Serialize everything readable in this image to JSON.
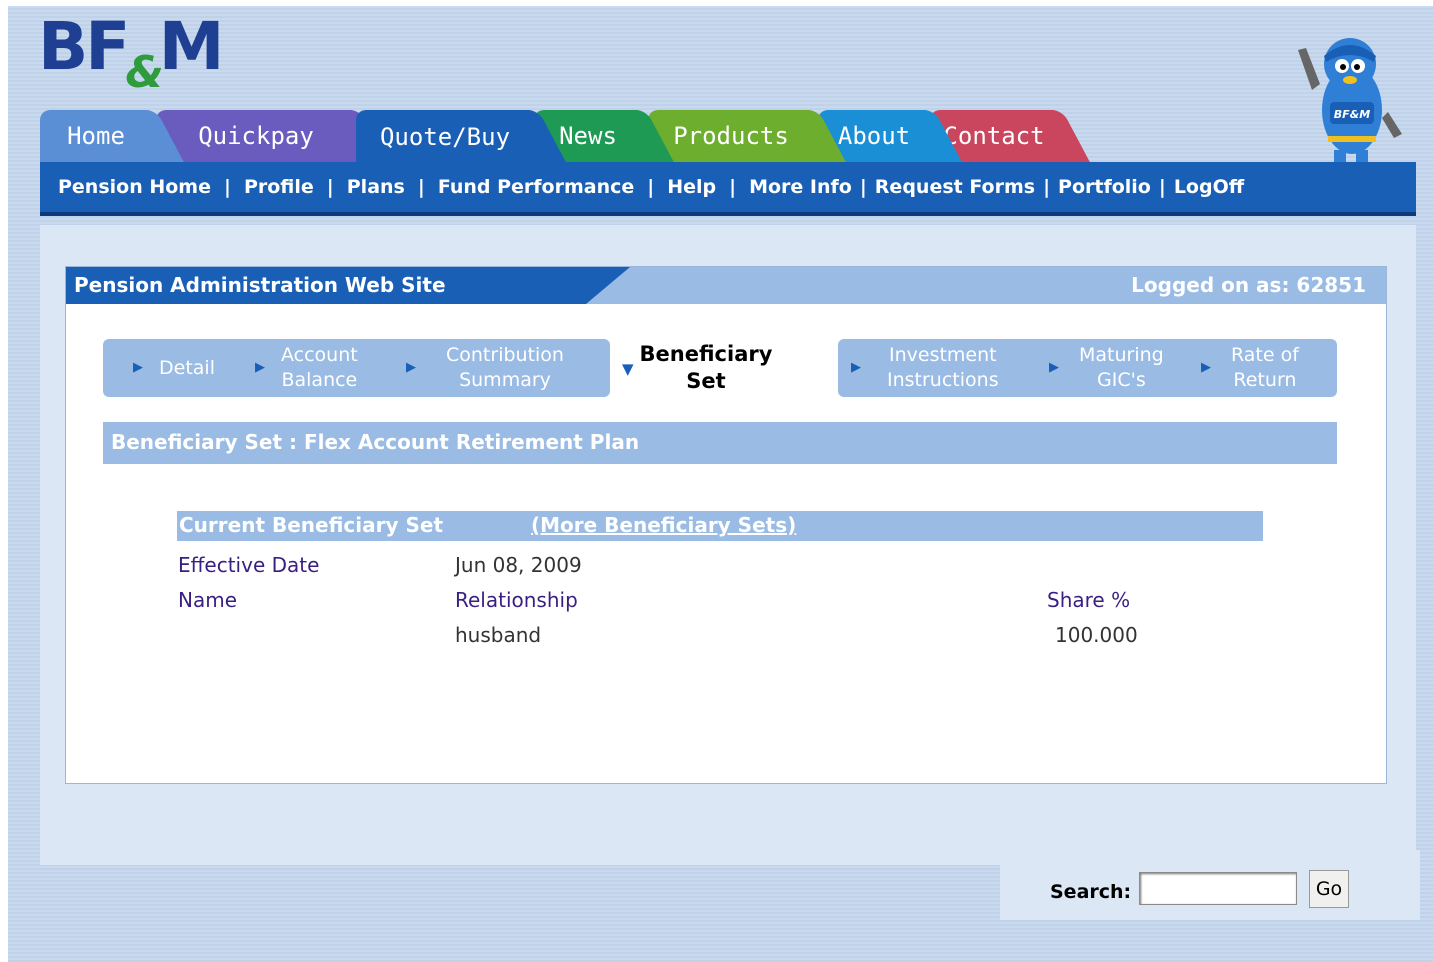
{
  "brand": {
    "logo_left": "BF",
    "logo_amp": "&",
    "logo_right": "M",
    "mascot_badge": "BF&M"
  },
  "tabs": [
    {
      "label": "Home",
      "color": "#5a8fd6"
    },
    {
      "label": "Quickpay",
      "color": "#6a5bbf"
    },
    {
      "label": "Quote/Buy",
      "color": "#1a5fb6"
    },
    {
      "label": "News",
      "color": "#1f9a55"
    },
    {
      "label": "Products",
      "color": "#6dae2e"
    },
    {
      "label": "About",
      "color": "#1a8fd6"
    },
    {
      "label": "Contact",
      "color": "#c9465e"
    }
  ],
  "nav": {
    "items": [
      "Pension Home",
      "Profile",
      "Plans",
      "Fund Performance",
      "Help",
      "More Info",
      "Request Forms",
      "Portfolio",
      "LogOff"
    ],
    "separator": "|"
  },
  "header": {
    "title": "Pension Administration Web Site",
    "logged_on": "Logged on as: 62851"
  },
  "steps": [
    {
      "line1": "Detail",
      "line2": ""
    },
    {
      "line1": "Account",
      "line2": "Balance"
    },
    {
      "line1": "Contribution",
      "line2": "Summary"
    },
    {
      "line1": "Beneficiary",
      "line2": "Set"
    },
    {
      "line1": "Investment",
      "line2": "Instructions"
    },
    {
      "line1": "Maturing",
      "line2": "GIC's"
    },
    {
      "line1": "Rate of",
      "line2": "Return"
    }
  ],
  "section_title": "Beneficiary Set : Flex Account Retirement Plan",
  "beneficiary": {
    "current_label": "Current Beneficiary Set",
    "more_link": "(More Beneficiary Sets)",
    "effective_label": "Effective Date",
    "effective_value": "Jun 08, 2009",
    "col_name": "Name",
    "col_relationship": "Relationship",
    "col_share": "Share %",
    "rows": [
      {
        "name": "",
        "relationship": "husband",
        "share": "100.000"
      }
    ]
  },
  "search": {
    "label": "Search:",
    "value": "",
    "button": "Go"
  },
  "colors": {
    "primary_blue": "#1a5fb6",
    "light_blue": "#99bbe4",
    "label_purple": "#3a1f82"
  }
}
